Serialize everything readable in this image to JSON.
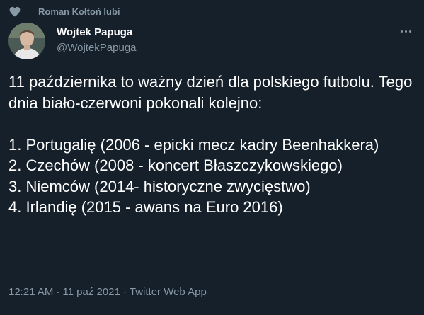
{
  "social_context": {
    "text": "Roman Kołtoń lubi",
    "icon": "heart-icon"
  },
  "author": {
    "display_name": "Wojtek Papuga",
    "handle": "@WojtekPapuga",
    "avatar": "avatar"
  },
  "more_menu": {
    "icon": "more-horizontal-icon"
  },
  "tweet": {
    "paragraphs": [
      "11 października to ważny dzień dla polskiego futbolu. Tego dnia biało-czerwoni pokonali kolejno:",
      "",
      "1. Portugalię (2006 - epicki mecz kadry Beenhakkera)",
      "2. Czechów (2008 - koncert Błaszczykowskiego)",
      "3. Niemców (2014- historyczne zwycięstwo)",
      "4. Irlandię (2015 - awans na Euro 2016)"
    ]
  },
  "meta": {
    "time": "12:21 AM",
    "separator": "·",
    "date": "11 paź 2021",
    "app": "Twitter Web App"
  },
  "colors": {
    "background": "#15202b",
    "primary_text": "#ffffff",
    "secondary_text": "#8899a6"
  }
}
